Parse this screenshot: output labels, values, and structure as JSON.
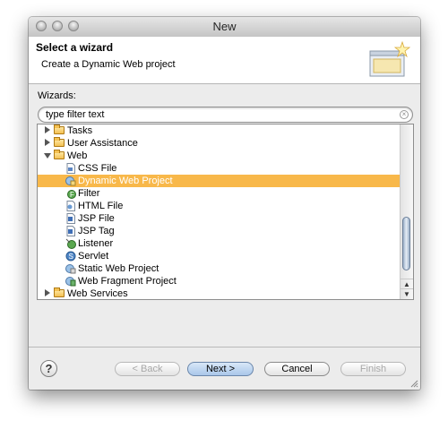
{
  "window": {
    "title": "New"
  },
  "header": {
    "title": "Select a wizard",
    "description": "Create a Dynamic Web project"
  },
  "wizards": {
    "label": "Wizards:",
    "filter_value": "type filter text"
  },
  "tree": {
    "items": [
      {
        "label": "Tasks"
      },
      {
        "label": "User Assistance"
      },
      {
        "label": "Web"
      },
      {
        "label": "CSS File"
      },
      {
        "label": "Dynamic Web Project"
      },
      {
        "label": "Filter"
      },
      {
        "label": "HTML File"
      },
      {
        "label": "JSP File"
      },
      {
        "label": "JSP Tag"
      },
      {
        "label": "Listener"
      },
      {
        "label": "Servlet"
      },
      {
        "label": "Static Web Project"
      },
      {
        "label": "Web Fragment Project"
      },
      {
        "label": "Web Services"
      }
    ]
  },
  "buttons": {
    "help": "?",
    "back": "< Back",
    "next": "Next >",
    "cancel": "Cancel",
    "finish": "Finish"
  },
  "colors": {
    "selection": "#f8b84a",
    "accent": "#a9c7ea"
  },
  "icons": {
    "help": "help-icon",
    "clear": "clear-search-icon",
    "folder": "folder-icon",
    "file": "file-icon",
    "wizard": "wizard-banner-icon"
  }
}
